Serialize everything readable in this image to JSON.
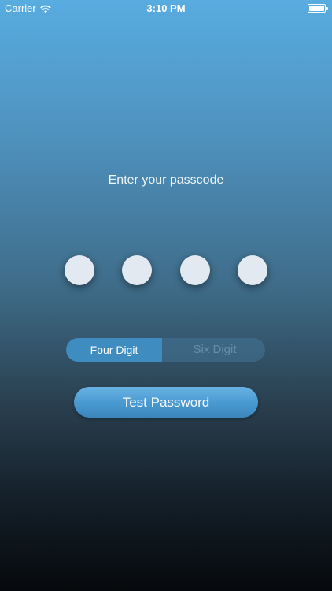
{
  "status_bar": {
    "carrier": "Carrier",
    "time": "3:10 PM",
    "wifi_icon": "wifi-icon",
    "battery_icon": "battery-full-icon"
  },
  "passcode": {
    "prompt": "Enter your passcode",
    "digit_count_shown": 4,
    "digits_entered": 0
  },
  "segmented_control": {
    "options": [
      "Four Digit",
      "Six Digit"
    ],
    "selected": "Four Digit"
  },
  "actions": {
    "test_button_label": "Test Password"
  },
  "colors": {
    "gradient_top": "#58ace0",
    "gradient_bottom": "#06090c",
    "dot_fill": "#e3e9f1",
    "segment_active": "#3e8cc0",
    "button_fill": "#4a9ad2"
  }
}
